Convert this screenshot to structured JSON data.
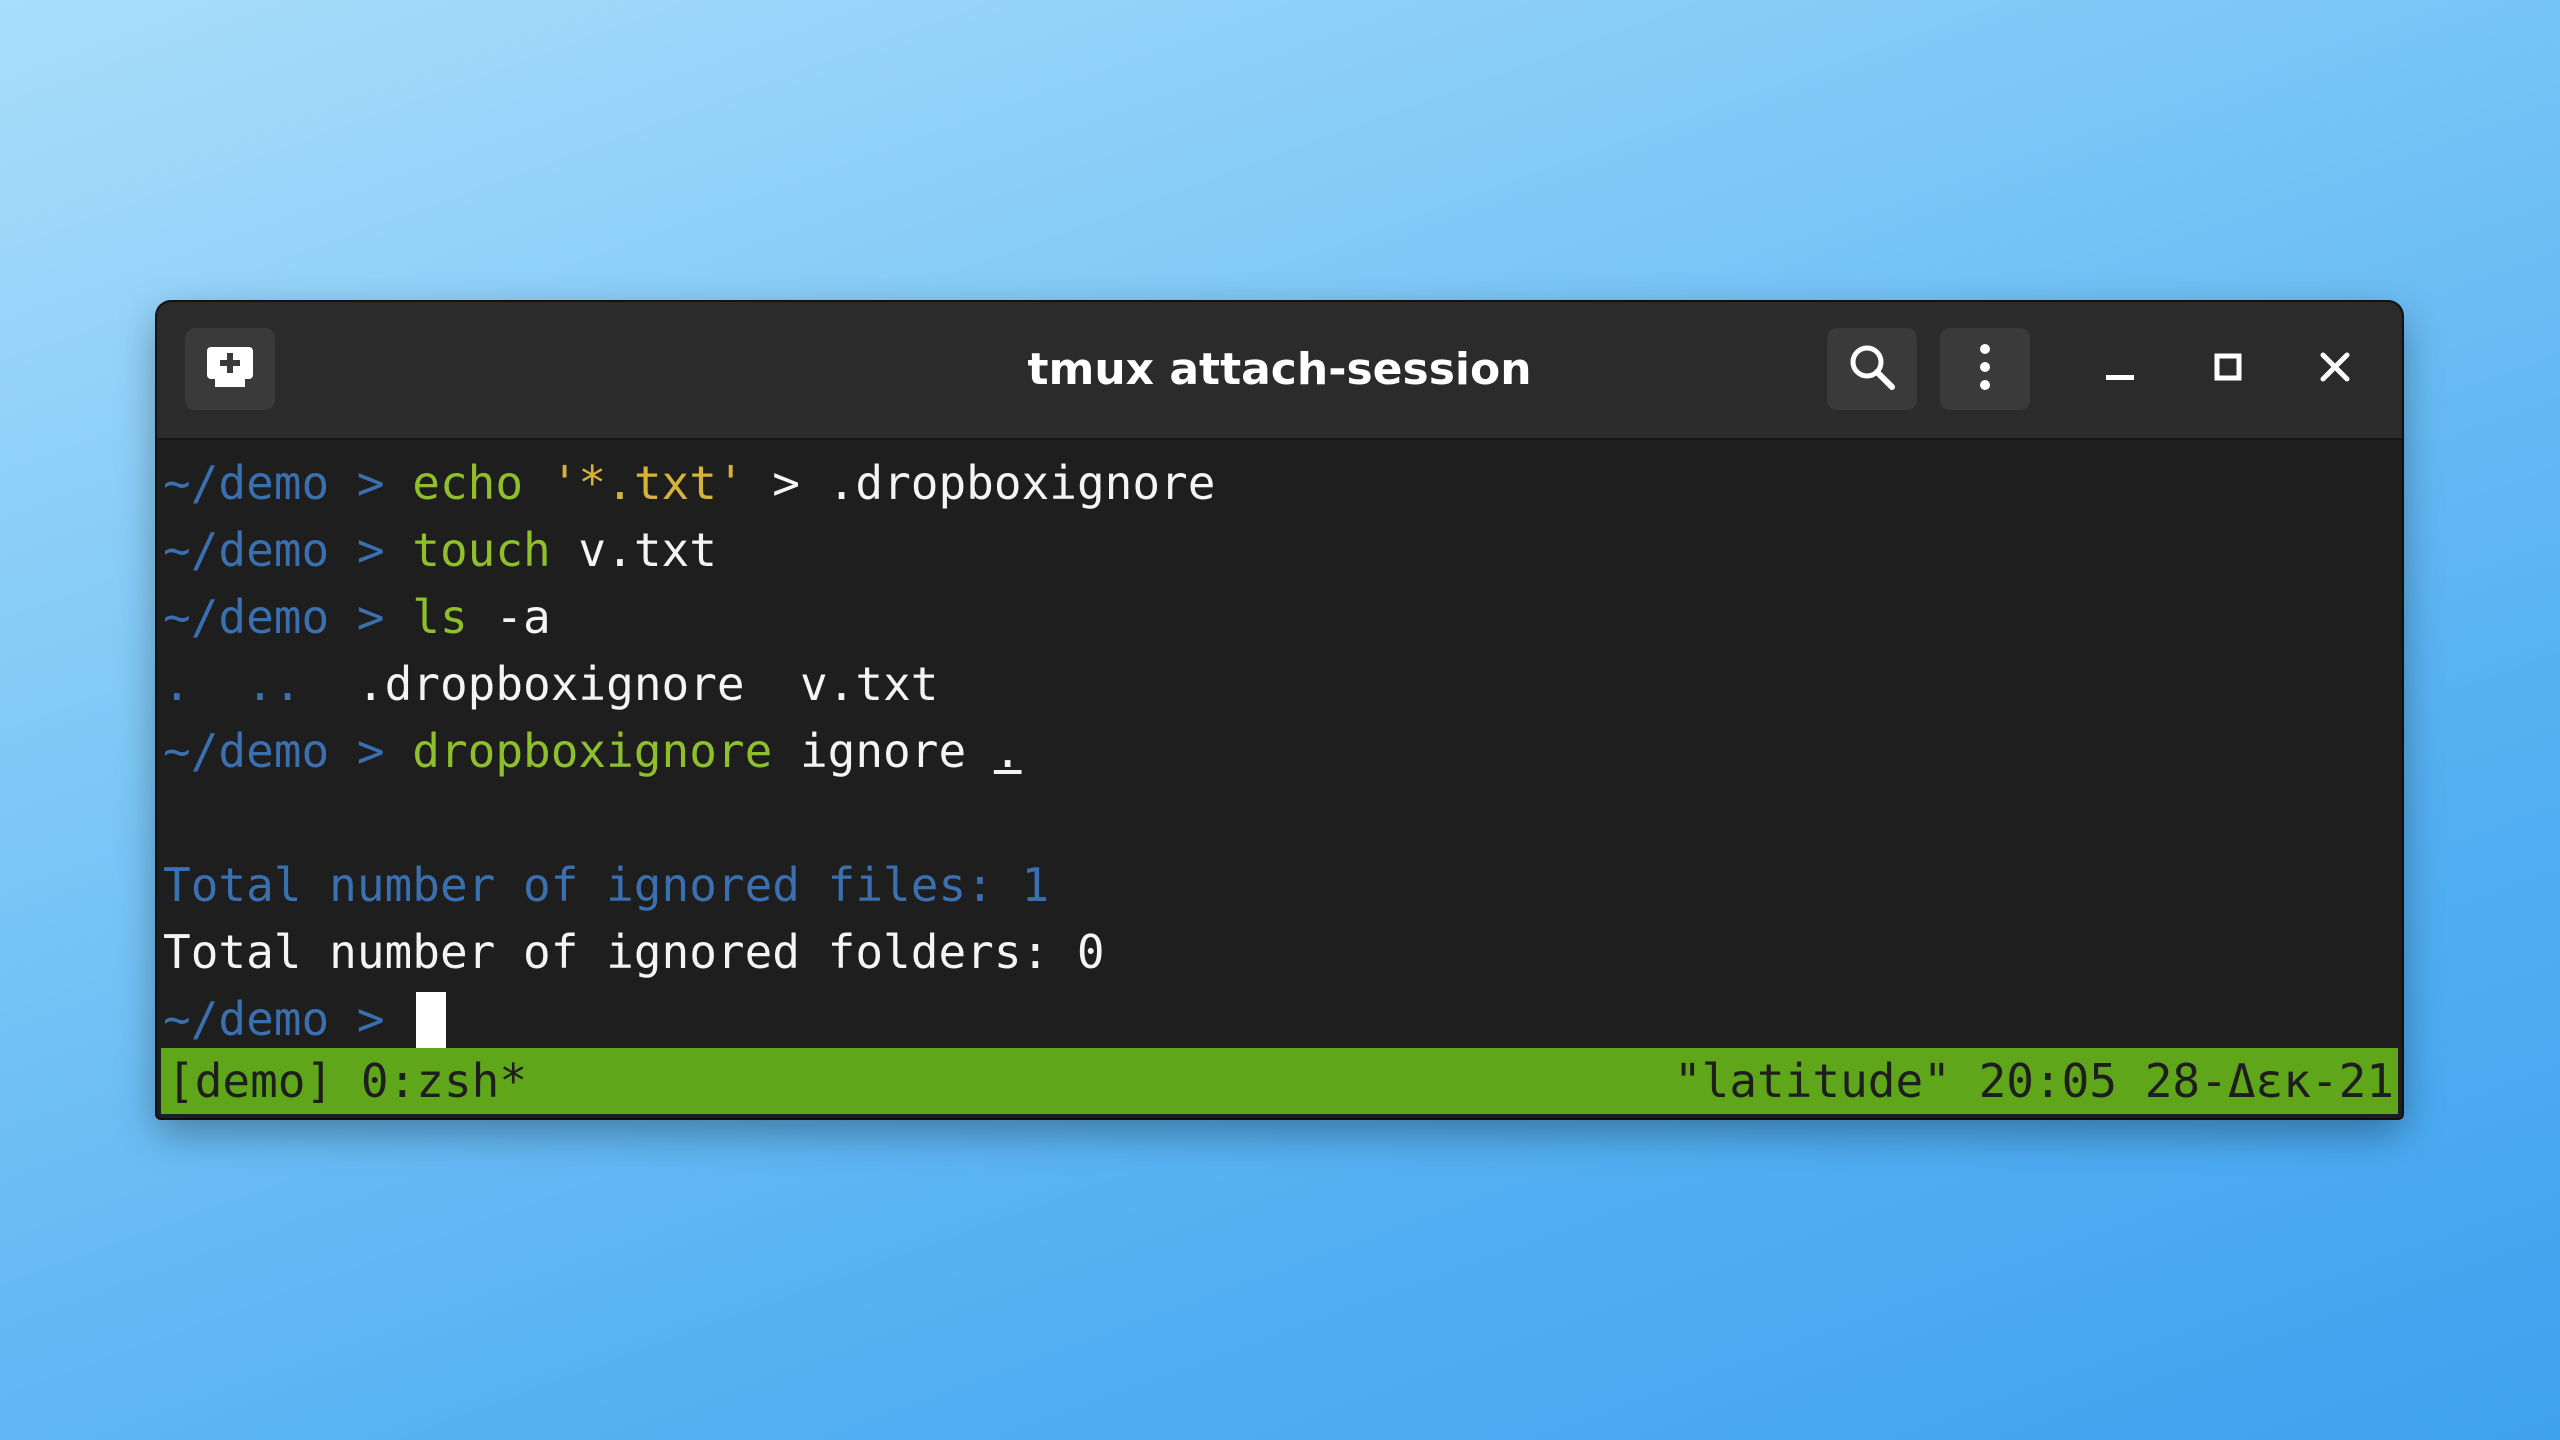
{
  "window": {
    "title": "tmux attach-session"
  },
  "titlebar": {
    "new_tab_icon": "new-tab-icon",
    "search_icon": "search-icon",
    "menu_icon": "kebab-menu-icon",
    "minimize_icon": "minimize-icon",
    "maximize_icon": "maximize-icon",
    "close_icon": "close-icon"
  },
  "terminal": {
    "lines": [
      {
        "prompt": "~/demo > ",
        "cmd": "echo",
        "sp1": " ",
        "str": "'*.txt'",
        "rest": " > .dropboxignore"
      },
      {
        "prompt": "~/demo > ",
        "cmd": "touch",
        "rest": " v.txt"
      },
      {
        "prompt": "~/demo > ",
        "cmd": "ls",
        "rest": " -a"
      },
      {
        "dots": ".  ..",
        "rest": "  .dropboxignore  v.txt"
      },
      {
        "prompt": "~/demo > ",
        "cmd": "dropboxignore",
        "rest": " ignore ",
        "arg": "."
      },
      {
        "text": ""
      },
      {
        "text": "Total number of ignored files: 1"
      },
      {
        "text": "Total number of ignored folders: 0"
      },
      {
        "prompt": "~/demo > "
      }
    ]
  },
  "statusbar": {
    "left": "[demo] 0:zsh*",
    "right": "\"latitude\" 20:05 28-Δεκ-21"
  },
  "colors": {
    "prompt": "#3a6fb0",
    "command": "#8fbf2b",
    "string": "#d7b23a",
    "status_bg": "#5fa61b",
    "terminal_bg": "#1e1e1e"
  }
}
